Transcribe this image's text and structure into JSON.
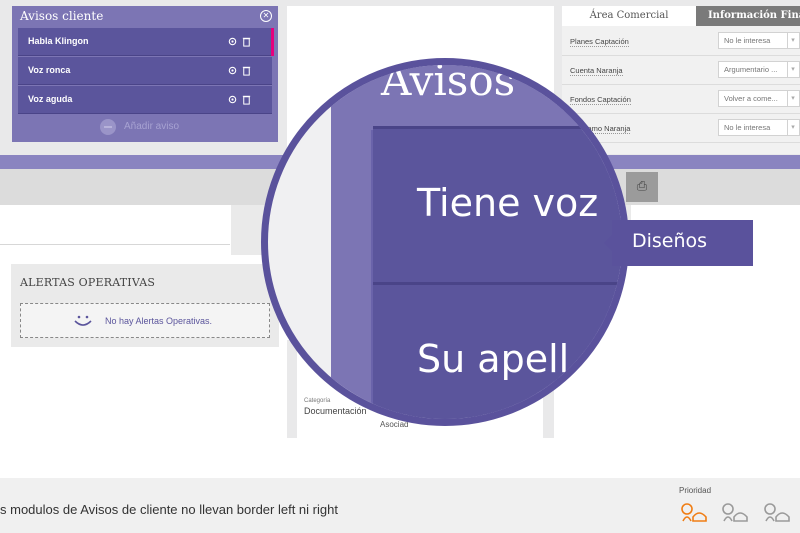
{
  "avisos": {
    "title": "Avisos cliente",
    "items": [
      {
        "label": "Habla Klingon"
      },
      {
        "label": "Voz ronca"
      },
      {
        "label": "Voz aguda"
      }
    ],
    "add_label": "Añadir aviso",
    "accent_color": "#e6007e"
  },
  "area": {
    "tab_active": "Área Comercial",
    "tab_other": "Información Financi",
    "rows": [
      {
        "key": "Planes Captación",
        "value": "No le interesa"
      },
      {
        "key": "Cuenta Naranja",
        "value": "Argumentario ..."
      },
      {
        "key": "Fondos Captación",
        "value": "Volver a come..."
      },
      {
        "key": "Préstamo Naranja",
        "value": "No le interesa"
      }
    ]
  },
  "alertas": {
    "title": "ALERTAS OPERATIVAS",
    "empty_message": "No hay Alertas Operativas."
  },
  "lower": {
    "category_label": "Categoría",
    "category_value": "Documentación",
    "associated": "Asociad"
  },
  "magnifier": {
    "title": "Avisos",
    "item1": "Tiene voz",
    "item2": "Su apell",
    "tooltip": "Diseños"
  },
  "footer": {
    "note": "s modulos de Avisos de cliente no llevan border left ni right",
    "priority_label": "Prioridad"
  },
  "colors": {
    "brand_purple": "#5b559c",
    "panel_purple": "#7c75b4",
    "priority_orange": "#f07d14"
  }
}
